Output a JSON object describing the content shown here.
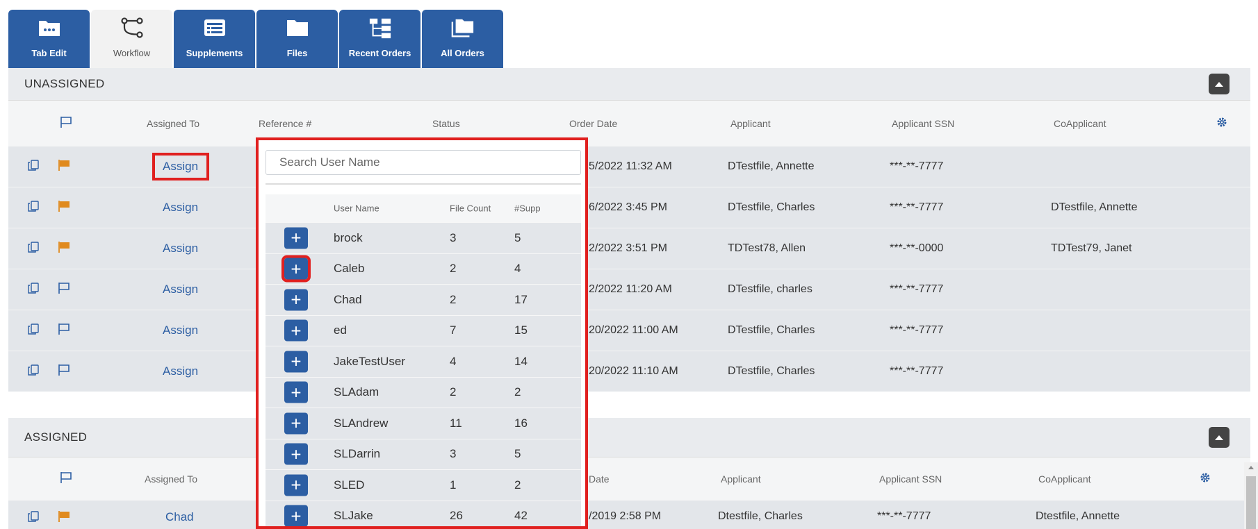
{
  "tabs": [
    {
      "label": "Tab Edit",
      "icon": "folder-dots-icon",
      "active": false
    },
    {
      "label": "Workflow",
      "icon": "workflow-icon",
      "active": true
    },
    {
      "label": "Supplements",
      "icon": "list-card-icon",
      "active": false
    },
    {
      "label": "Files",
      "icon": "folder-icon",
      "active": false
    },
    {
      "label": "Recent Orders",
      "icon": "tree-icon",
      "active": false
    },
    {
      "label": "All Orders",
      "icon": "folders-icon",
      "active": false
    }
  ],
  "unassigned": {
    "title": "UNASSIGNED",
    "headers": {
      "assigned_to": "Assigned To",
      "reference": "Reference #",
      "status": "Status",
      "order_date": "Order Date",
      "applicant": "Applicant",
      "ssn": "Applicant SSN",
      "coapplicant": "CoApplicant"
    },
    "rows": [
      {
        "assign": "Assign",
        "flag": "orange",
        "order_date": "5/2022 11:32 AM",
        "applicant": "DTestfile, Annette",
        "ssn": "***-**-7777",
        "coapplicant": ""
      },
      {
        "assign": "Assign",
        "flag": "orange",
        "order_date": "6/2022 3:45 PM",
        "applicant": "DTestfile, Charles",
        "ssn": "***-**-7777",
        "coapplicant": "DTestfile, Annette"
      },
      {
        "assign": "Assign",
        "flag": "orange",
        "order_date": "2/2022 3:51 PM",
        "applicant": "TDTest78, Allen",
        "ssn": "***-**-0000",
        "coapplicant": "TDTest79, Janet"
      },
      {
        "assign": "Assign",
        "flag": "outline",
        "order_date": "2/2022 11:20 AM",
        "applicant": "DTestfile, charles",
        "ssn": "***-**-7777",
        "coapplicant": ""
      },
      {
        "assign": "Assign",
        "flag": "outline",
        "order_date": "20/2022 11:00 AM",
        "applicant": "DTestfile, Charles",
        "ssn": "***-**-7777",
        "coapplicant": ""
      },
      {
        "assign": "Assign",
        "flag": "outline",
        "order_date": "20/2022 11:10 AM",
        "applicant": "DTestfile, Charles",
        "ssn": "***-**-7777",
        "coapplicant": ""
      }
    ]
  },
  "assigned": {
    "title": "ASSIGNED",
    "headers": {
      "assigned_to": "Assigned To",
      "order_date": "Date",
      "applicant": "Applicant",
      "ssn": "Applicant SSN",
      "coapplicant": "CoApplicant"
    },
    "rows": [
      {
        "assignee": "Chad",
        "flag": "orange",
        "order_date": "/2019 2:58 PM",
        "applicant": "Dtestfile, Charles",
        "ssn": "***-**-7777",
        "coapplicant": "Dtestfile, Annette"
      }
    ]
  },
  "popup": {
    "search_placeholder": "Search User Name",
    "headers": {
      "user": "User Name",
      "files": "File Count",
      "supp": "#Supp"
    },
    "users": [
      {
        "name": "brock",
        "files": "3",
        "supp": "5"
      },
      {
        "name": "Caleb",
        "files": "2",
        "supp": "4"
      },
      {
        "name": "Chad",
        "files": "2",
        "supp": "17"
      },
      {
        "name": "ed",
        "files": "7",
        "supp": "15"
      },
      {
        "name": "JakeTestUser",
        "files": "4",
        "supp": "14"
      },
      {
        "name": "SLAdam",
        "files": "2",
        "supp": "2"
      },
      {
        "name": "SLAndrew",
        "files": "11",
        "supp": "16"
      },
      {
        "name": "SLDarrin",
        "files": "3",
        "supp": "5"
      },
      {
        "name": "SLED",
        "files": "1",
        "supp": "2"
      },
      {
        "name": "SLJake",
        "files": "26",
        "supp": "42"
      }
    ]
  },
  "colors": {
    "primary": "#2c5ea3",
    "flag": "#e08a1e",
    "highlight": "#e0201f"
  }
}
